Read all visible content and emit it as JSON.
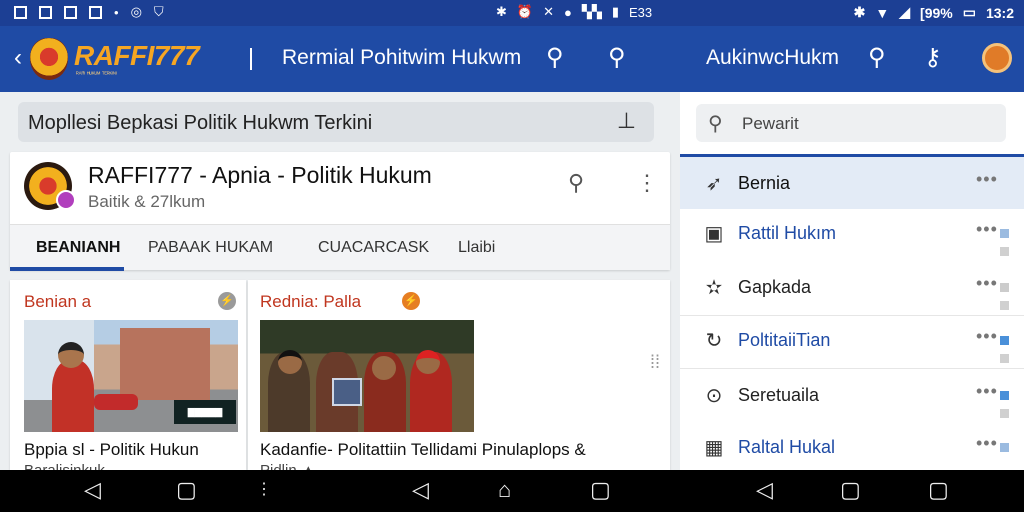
{
  "status_bar": {
    "time_mid": "E33",
    "time_right": "13:2",
    "battery_text": "[99%"
  },
  "app_bar": {
    "brand": "RAFFI777",
    "brand_tagline": "ᴿᴬᶠᶠᴵ ᴴᵁᴷᵁᴹ ᵀᴱᴿᴷᴵᴺᴵ",
    "title": "Rermial Pohitwim Hukwm",
    "title_right": "AukinwcHukm"
  },
  "search": {
    "text": "Mopllesi Bepkasi Politik Hukwm Terkini"
  },
  "header_card": {
    "title": "RAFFI777 - Apnia - Politik Hukum",
    "subtitle": "Baitik & 27lkum",
    "tabs": [
      {
        "label": "BEANIANH"
      },
      {
        "label": "PABAAK HUKAM"
      },
      {
        "label": "CUACARCASK"
      },
      {
        "label": "Llaibi"
      }
    ]
  },
  "news": [
    {
      "label": "Benian a",
      "image_caption": "▇▇▇▇▇",
      "title": "Bppia sl - Politik Hukun",
      "subtitle": "Baralisinkuk"
    },
    {
      "label": "Rednia: Palla",
      "title": "Kadanfie- Politattiin Tellidami Pinulaplops  &",
      "subtitle": "Pidlin ▲"
    }
  ],
  "right_panel": {
    "search_placeholder": "Pewarit",
    "items": [
      {
        "label": "Bernia",
        "icon": "trending-icon",
        "color": "#111111"
      },
      {
        "label": "Rattil Hukım",
        "icon": "document-icon",
        "color": "#1f4ba5",
        "mark": "#9bbbe0"
      },
      {
        "label": "Gapkada",
        "icon": "star-icon",
        "color": "#222222",
        "mark": "#cccccc"
      },
      {
        "label": "PoltitaiiTian",
        "icon": "refresh-icon",
        "color": "#1f4ba5",
        "mark": "#4a90d9"
      },
      {
        "label": "Seretuaila",
        "icon": "compass-icon",
        "color": "#222222",
        "mark": "#4a90d9"
      },
      {
        "label": "Raltal Hukal",
        "icon": "calendar-icon",
        "color": "#1f4ba5",
        "mark": "#9bbbe0"
      }
    ]
  },
  "colors": {
    "app_bar": "#1f4ba5",
    "brand": "#f6a623",
    "accent_red": "#c0361f"
  }
}
